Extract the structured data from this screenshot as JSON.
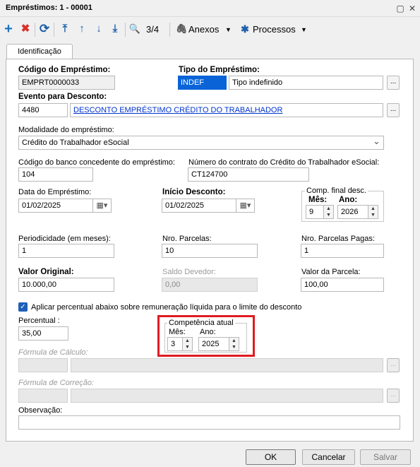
{
  "window": {
    "title": "Empréstimos: 1 - 00001",
    "restore_glyph": "▢",
    "close_glyph": "✕"
  },
  "toolbar": {
    "icons": [
      "plus-icon",
      "delete-x-icon",
      "refresh-icon",
      "first-record-icon",
      "previous-record-icon",
      "next-record-icon",
      "last-record-icon",
      "search-icon"
    ],
    "glyphs": {
      "add": "+",
      "delete": "✖",
      "refresh": "⟳",
      "first": "⤒",
      "prev": "↑",
      "next": "↓",
      "last": "⤓",
      "search": "🔍",
      "attach": "🖇",
      "gear": "✱",
      "caret": "▼"
    },
    "record_counter": "3/4",
    "attachments_label": "Anexos",
    "processes_label": "Processos"
  },
  "tabs": [
    {
      "label": "Identificação",
      "active": true
    }
  ],
  "form": {
    "codigo": {
      "label": "Código do Empréstimo:",
      "value": "EMPRT0000033"
    },
    "tipo": {
      "label": "Tipo do Empréstimo:",
      "code": "INDEF",
      "description": "Tipo indefinido"
    },
    "evento": {
      "label": "Evento para Desconto:",
      "code": "4480",
      "description": "DESCONTO EMPRÉSTIMO CRÉDITO DO TRABALHADOR"
    },
    "modalidade": {
      "label": "Modalidade do empréstimo:",
      "value": "Crédito do Trabalhador eSocial"
    },
    "codigo_banco": {
      "label": "Código do banco concedente do empréstimo:",
      "value": "104"
    },
    "numero_contrato": {
      "label": "Número do contrato do Crédito do Trabalhador eSocial:",
      "value": "CT124700"
    },
    "data_emprestimo": {
      "label": "Data do Empréstimo:",
      "value": "01/02/2025"
    },
    "inicio_desconto": {
      "label": "Início Desconto:",
      "value": "01/02/2025"
    },
    "comp_final": {
      "title": "Comp. final desc.",
      "mes_label": "Mês:",
      "ano_label": "Ano:",
      "mes": "9",
      "ano": "2026"
    },
    "periodicidade": {
      "label": "Periodicidade (em meses):",
      "value": "1"
    },
    "nro_parcelas": {
      "label": "Nro. Parcelas:",
      "value": "10"
    },
    "nro_parcelas_pagas": {
      "label": "Nro. Parcelas Pagas:",
      "value": "1"
    },
    "valor_original": {
      "label": "Valor Original:",
      "value": "10.000,00"
    },
    "saldo_devedor": {
      "label": "Saldo Devedor:",
      "value": "0,00"
    },
    "valor_parcela": {
      "label": "Valor da Parcela:",
      "value": "100,00"
    },
    "aplicar_percentual": {
      "label": "Aplicar percentual abaixo sobre remuneração líquida para o limite do desconto",
      "checked": true
    },
    "percentual": {
      "label": "Percentual :",
      "value": "35,00"
    },
    "competencia_atual": {
      "title": "Competência atual",
      "mes_label": "Mês:",
      "ano_label": "Ano:",
      "mes": "3",
      "ano": "2025"
    },
    "formula_calculo": {
      "label": "Fórmula de Cálculo:"
    },
    "formula_correcao": {
      "label": "Fórmula de Correção:"
    },
    "observacao": {
      "label": "Observação:",
      "value": ""
    }
  },
  "glyphs": {
    "ellipsis": "...",
    "calendar": "▦▾",
    "spin_up": "▲",
    "spin_down": "▼",
    "check": "✓",
    "chevron": "⌄"
  },
  "buttons": {
    "ok": "OK",
    "cancel": "Cancelar",
    "save": "Salvar"
  },
  "colors": {
    "highlight": "#e01b22",
    "link": "#0033cc",
    "selection": "#0a64d8",
    "add_icon": "#1e73be",
    "delete_icon": "#d9302c"
  }
}
